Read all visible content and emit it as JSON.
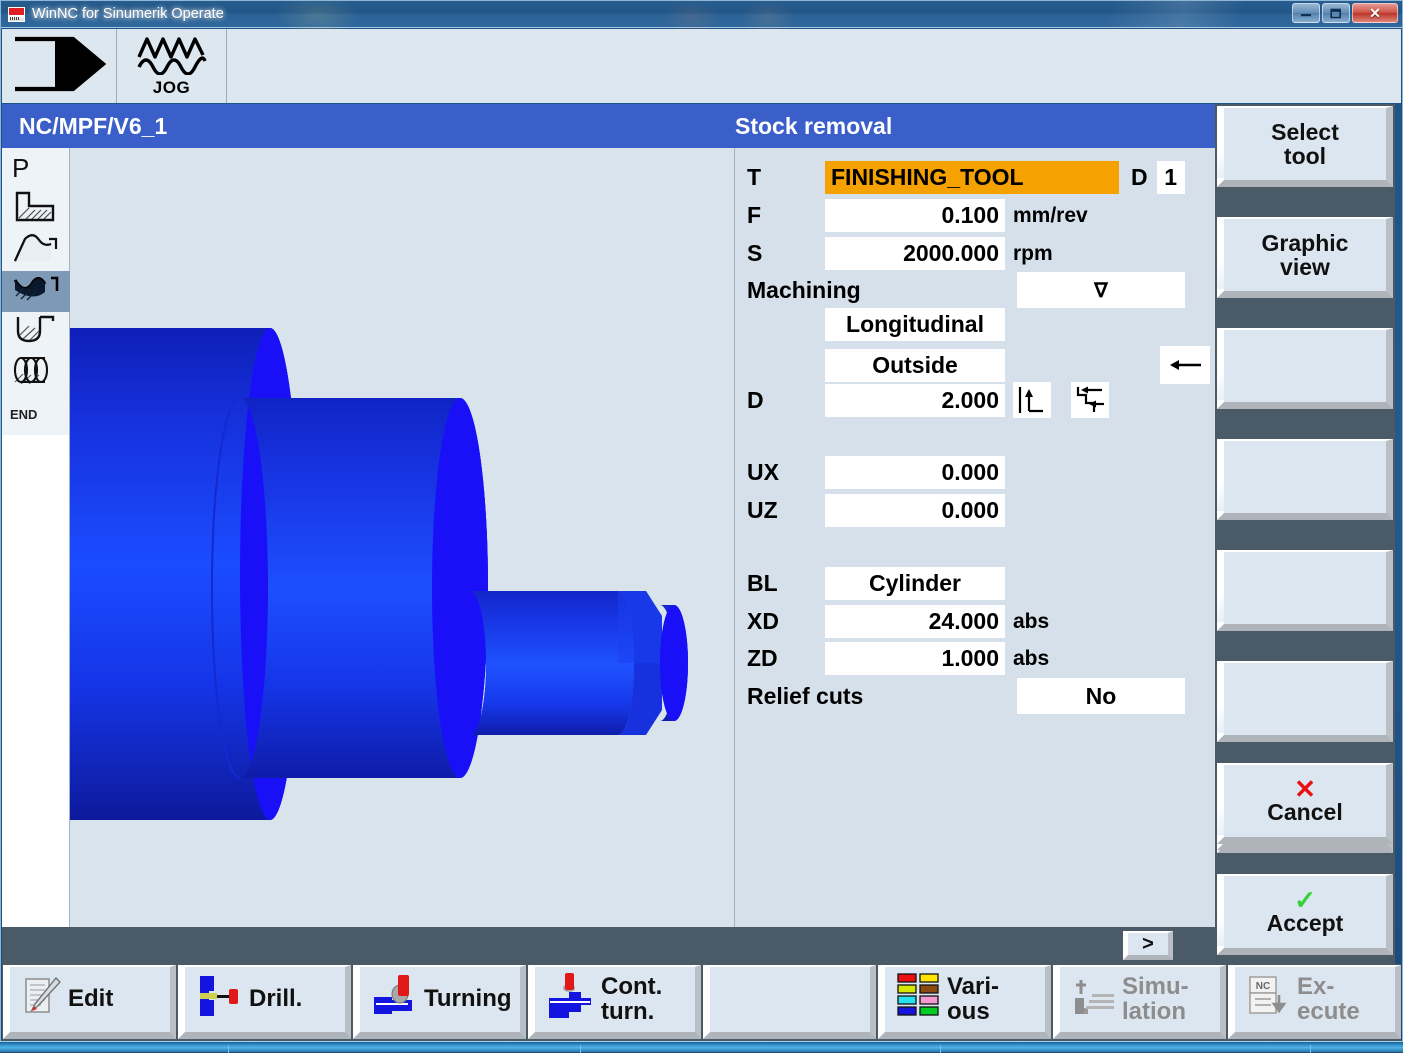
{
  "window": {
    "title": "WinNC for Sinumerik Operate",
    "buttons": {
      "minimize": "—",
      "maximize": "❐",
      "close": "✕"
    }
  },
  "modebar": {
    "channel_icon": "channel-arrow-icon",
    "jog_label": "JOG",
    "jog_icon": "jog-wave-icon"
  },
  "header": {
    "path": "NC/MPF/V6_1",
    "title": "Stock removal"
  },
  "rail": {
    "items": [
      {
        "name": "program-p",
        "label": "P",
        "icon": "letter-p-icon",
        "selected": false
      },
      {
        "name": "stock-removal-step",
        "label": "",
        "icon": "step-profile-icon",
        "selected": false
      },
      {
        "name": "contour",
        "label": "",
        "icon": "contour-curve-icon",
        "selected": false
      },
      {
        "name": "stock-removal",
        "label": "",
        "icon": "stock-removal-icon",
        "selected": true
      },
      {
        "name": "groove",
        "label": "",
        "icon": "groove-icon",
        "selected": false
      },
      {
        "name": "thread",
        "label": "",
        "icon": "thread-icon",
        "selected": false
      },
      {
        "name": "end",
        "label": "END",
        "icon": "end-marker-icon",
        "selected": false
      }
    ]
  },
  "form": {
    "tool": {
      "label": "T",
      "value": "FINISHING_TOOL",
      "d_label": "D",
      "d_value": "1"
    },
    "feed": {
      "label": "F",
      "value": "0.100",
      "unit": "mm/rev"
    },
    "speed": {
      "label": "S",
      "value": "2000.000",
      "unit": "rpm"
    },
    "machining": {
      "label": "Machining",
      "value": "∇",
      "dropdown_icon": "chevron-down-icon"
    },
    "direction_1": {
      "value": "Longitudinal"
    },
    "direction_2": {
      "value": "Outside"
    },
    "depth": {
      "label": "D",
      "value": "2.000"
    },
    "icon_corner": "corner-up-axis-icon",
    "icon_stair": "stair-left-arrows-icon",
    "icon_arrow_left": "arrow-left-icon",
    "ux": {
      "label": "UX",
      "value": "0.000"
    },
    "uz": {
      "label": "UZ",
      "value": "0.000"
    },
    "blank": {
      "label": "BL",
      "value": "Cylinder"
    },
    "xd": {
      "label": "XD",
      "value": "24.000",
      "unit": "abs"
    },
    "zd": {
      "label": "ZD",
      "value": "1.000",
      "unit": "abs"
    },
    "relief": {
      "label": "Relief cuts",
      "value": "No"
    }
  },
  "softkeys_vertical": [
    {
      "name": "select-tool",
      "line1": "Select",
      "line2": "tool"
    },
    {
      "name": "graphic-view",
      "line1": "Graphic",
      "line2": "view"
    },
    {
      "name": "softkey-3",
      "line1": "",
      "line2": ""
    },
    {
      "name": "softkey-4",
      "line1": "",
      "line2": ""
    },
    {
      "name": "softkey-5",
      "line1": "",
      "line2": ""
    },
    {
      "name": "softkey-6",
      "line1": "",
      "line2": ""
    },
    {
      "name": "softkey-7",
      "line1": "",
      "line2": ""
    },
    {
      "name": "cancel",
      "line1": "Cancel",
      "line2": "",
      "mark": "✕",
      "mark_color": "#e81010"
    },
    {
      "name": "accept",
      "line1": "Accept",
      "line2": "",
      "mark": "✓",
      "mark_color": "#33d133"
    }
  ],
  "status_strip": {
    "more_label": ">"
  },
  "softkeys_horizontal": [
    {
      "name": "edit",
      "line1": "Edit",
      "line2": "",
      "icon": "edit-pencil-icon",
      "disabled": false
    },
    {
      "name": "drill",
      "line1": "Drill.",
      "line2": "",
      "icon": "drill-icon",
      "disabled": false
    },
    {
      "name": "turning",
      "line1": "Turning",
      "line2": "",
      "icon": "turning-icon",
      "disabled": false
    },
    {
      "name": "contour-turning",
      "line1": "Cont.",
      "line2": "turn.",
      "icon": "contour-turning-icon",
      "disabled": false
    },
    {
      "name": "softkey-blank",
      "line1": "",
      "line2": "",
      "icon": "",
      "disabled": false
    },
    {
      "name": "various",
      "line1": "Vari-",
      "line2": "ous",
      "icon": "various-colors-icon",
      "disabled": false
    },
    {
      "name": "simulation",
      "line1": "Simu-",
      "line2": "lation",
      "icon": "simulation-icon",
      "disabled": true
    },
    {
      "name": "execute",
      "line1": "Ex-",
      "line2": "ecute",
      "icon": "nc-execute-icon",
      "disabled": true
    }
  ],
  "various_colors": [
    "#ee1111",
    "#ffe400",
    "#d7e800",
    "#8a4a11",
    "#25e2ee",
    "#f49ad0",
    "#1414dd",
    "#00cc22"
  ],
  "colors": {
    "header_blue": "#3b5fc8",
    "form_bg": "#d5e0ea",
    "canvas_bg": "#d9e3ec",
    "softkey_bg": "#dce6f0",
    "rail_selected": "#7e99b6",
    "highlight_orange": "#f5a200",
    "strip_dark": "#4a5a66",
    "workpiece_blue": "#1326f5"
  },
  "workpiece": {
    "description": "stepped turned shaft, 3 cylinder steps with tapered cone",
    "render_type": "3d-lathe-part"
  }
}
